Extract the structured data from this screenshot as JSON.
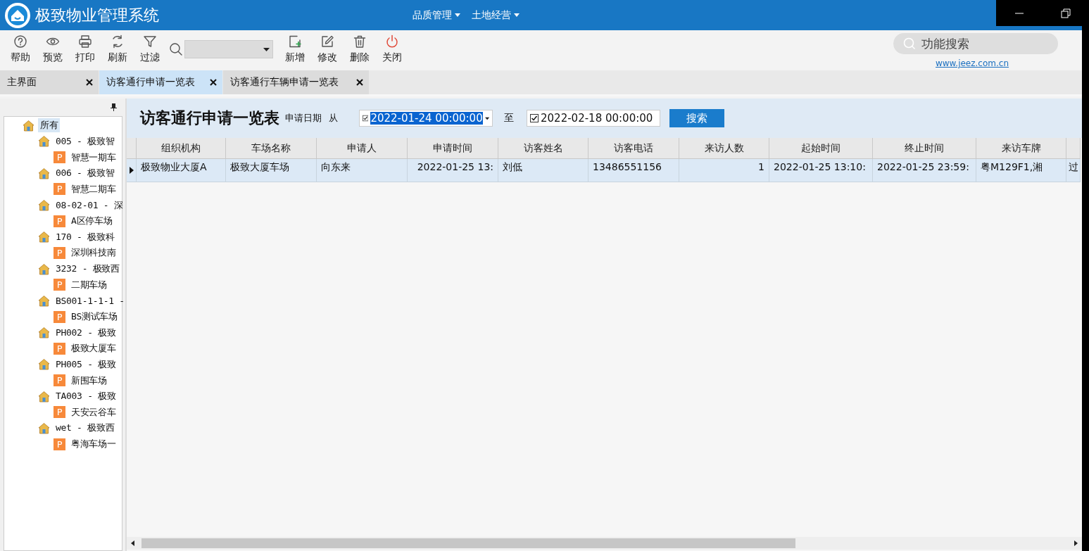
{
  "window": {
    "title": "极致物业管理系统"
  },
  "menus": [
    {
      "label": "品质管理"
    },
    {
      "label": "土地经营"
    }
  ],
  "toolbar": {
    "left_buttons": [
      {
        "label": "帮助"
      },
      {
        "label": "预览"
      },
      {
        "label": "打印"
      },
      {
        "label": "刷新"
      },
      {
        "label": "过滤"
      }
    ],
    "right_buttons": [
      {
        "label": "新增"
      },
      {
        "label": "修改"
      },
      {
        "label": "删除"
      },
      {
        "label": "关闭"
      }
    ]
  },
  "function_search": {
    "placeholder": "功能搜索"
  },
  "website_link": "www.jeez.com.cn",
  "tabs": [
    {
      "label": "主界面",
      "selected": false
    },
    {
      "label": "访客通行申请一览表",
      "selected": true
    },
    {
      "label": "访客通行车辆申请一览表",
      "selected": false
    }
  ],
  "tree": [
    {
      "label": "所有",
      "kind": "group",
      "selected": true,
      "children": [
        {
          "label": "005 - 极致智",
          "kind": "org",
          "selected": false,
          "children": [
            {
              "label": "智慧一期车",
              "badge": "P",
              "kind": "parking",
              "selected": false
            }
          ]
        },
        {
          "label": "006 - 极致智",
          "kind": "org",
          "selected": false,
          "children": [
            {
              "label": "智慧二期车",
              "badge": "P",
              "kind": "parking",
              "selected": false
            }
          ]
        },
        {
          "label": "08-02-01 - 深",
          "kind": "org",
          "selected": false,
          "children": [
            {
              "label": "A区停车场",
              "badge": "P",
              "kind": "parking",
              "selected": false
            }
          ]
        },
        {
          "label": "170 - 极致科",
          "kind": "org",
          "selected": false,
          "children": [
            {
              "label": "深圳科技南",
              "badge": "P",
              "kind": "parking",
              "selected": false
            }
          ]
        },
        {
          "label": "3232 - 极致西",
          "kind": "org",
          "selected": false,
          "children": [
            {
              "label": "二期车场",
              "badge": "P",
              "kind": "parking",
              "selected": false
            }
          ]
        },
        {
          "label": "BS001-1-1-1 -",
          "kind": "org",
          "selected": false,
          "children": [
            {
              "label": "BS测试车场",
              "badge": "P",
              "kind": "parking",
              "selected": false
            }
          ]
        },
        {
          "label": "PH002 - 极致",
          "kind": "org",
          "selected": false,
          "children": [
            {
              "label": "极致大厦车",
              "badge": "P",
              "kind": "parking",
              "selected": false
            }
          ]
        },
        {
          "label": "PH005 - 极致",
          "kind": "org",
          "selected": false,
          "children": [
            {
              "label": "新围车场",
              "badge": "P",
              "kind": "parking",
              "selected": false
            }
          ]
        },
        {
          "label": "TA003 - 极致",
          "kind": "org",
          "selected": false,
          "children": [
            {
              "label": "天安云谷车",
              "badge": "P",
              "kind": "parking",
              "selected": false
            }
          ]
        },
        {
          "label": "wet - 极致西",
          "kind": "org",
          "selected": false,
          "children": [
            {
              "label": "粤海车场一",
              "badge": "P",
              "kind": "parking",
              "selected": false
            }
          ]
        }
      ]
    }
  ],
  "report": {
    "title": "访客通行申请一览表",
    "date_label": "申请日期",
    "from_label": "从",
    "date_from": {
      "value": "2022-01-24 00:00:00",
      "checked": true,
      "focused": true
    },
    "to_label": "至",
    "date_to": {
      "value": "2022-02-18 00:00:00",
      "checked": true,
      "focused": false
    },
    "search_button": "搜索"
  },
  "table": {
    "columns": [
      {
        "label": "组织机构",
        "right_aligned": false
      },
      {
        "label": "车场名称",
        "right_aligned": false
      },
      {
        "label": "申请人",
        "right_aligned": false
      },
      {
        "label": "申请时间",
        "right_aligned": true
      },
      {
        "label": "访客姓名",
        "right_aligned": false
      },
      {
        "label": "访客电话",
        "right_aligned": false
      },
      {
        "label": "来访人数",
        "right_aligned": true
      },
      {
        "label": "起始时间",
        "right_aligned": false
      },
      {
        "label": "终止时间",
        "right_aligned": false
      },
      {
        "label": "来访车牌",
        "right_aligned": false
      }
    ],
    "rows": [
      {
        "selected": true,
        "cells": [
          "极致物业大厦A",
          "极致大厦车场",
          "向东来",
          "2022-01-25 13:",
          "刘低",
          "13486551156",
          "1",
          "2022-01-25 13:10:",
          "2022-01-25 23:59:",
          "粤M129F1,湘",
          "过"
        ]
      }
    ]
  }
}
